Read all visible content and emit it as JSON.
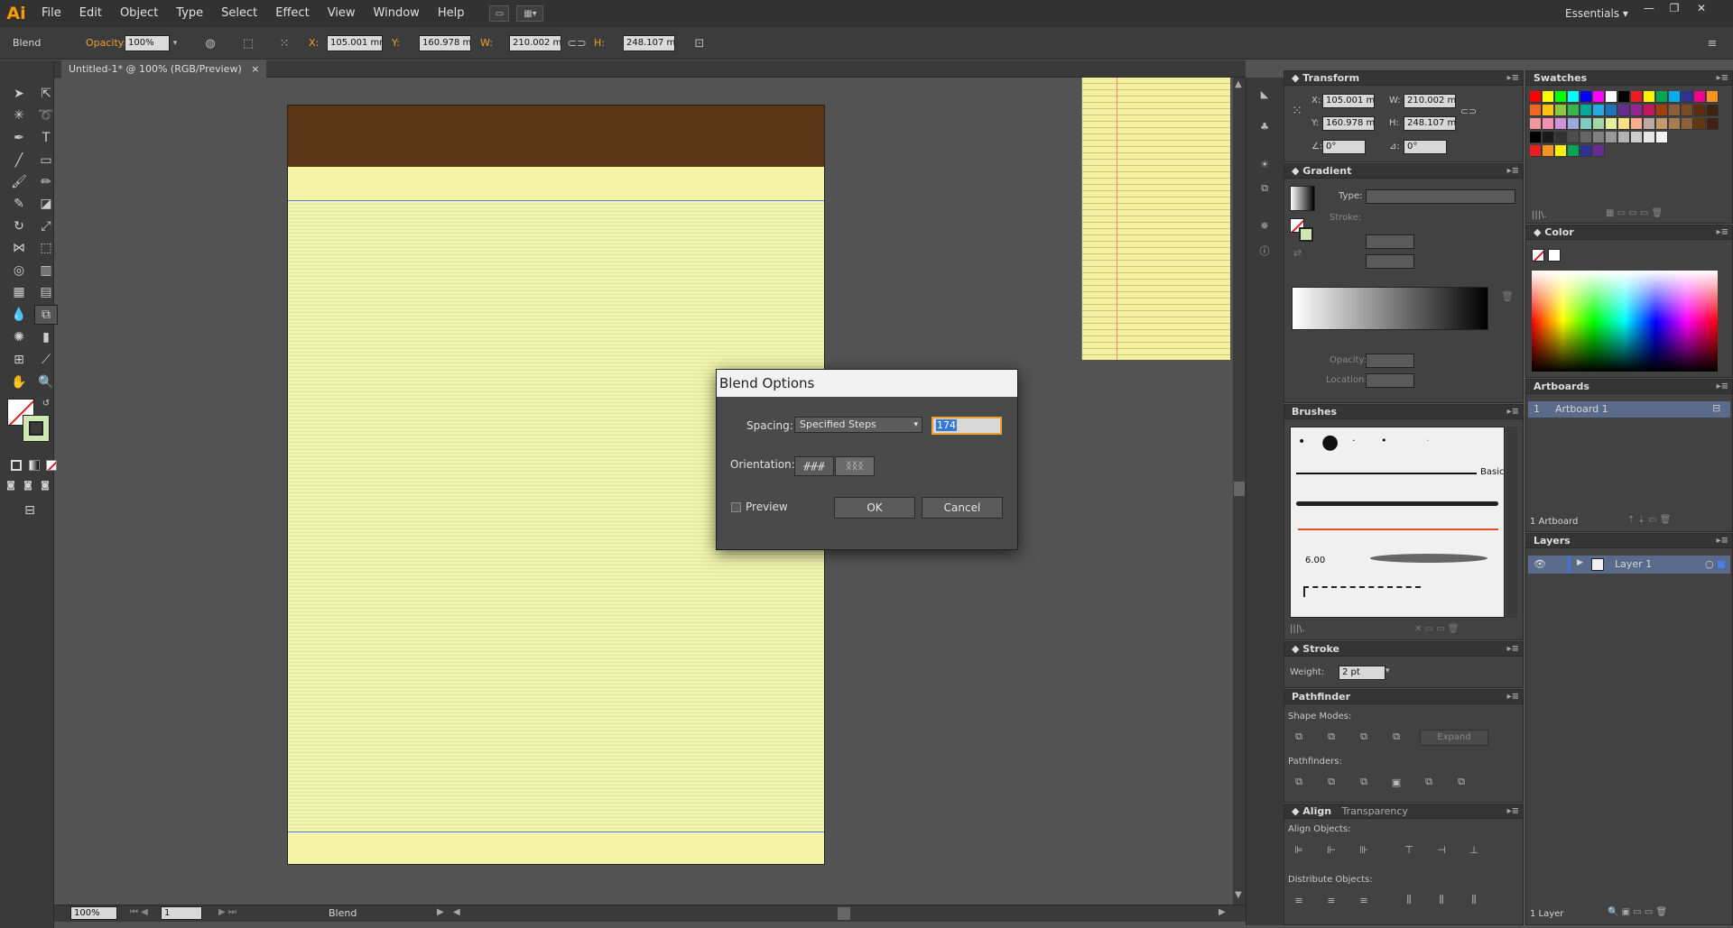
{
  "app": {
    "logo": "Ai"
  },
  "menu": [
    "File",
    "Edit",
    "Object",
    "Type",
    "Select",
    "Effect",
    "View",
    "Window",
    "Help"
  ],
  "workspace": "Essentials",
  "window_controls": {
    "minimize": "—",
    "restore": "❐",
    "close": "✕"
  },
  "control_bar": {
    "object_type": "Blend",
    "opacity_label": "Opacity:",
    "opacity_value": "100%",
    "x_label": "X:",
    "x_value": "105.001 mm",
    "y_label": "Y:",
    "y_value": "160.978 mm",
    "w_label": "W:",
    "w_value": "210.002 mm",
    "h_label": "H:",
    "h_value": "248.107 mm"
  },
  "document_tab": {
    "title": "Untitled-1* @ 100% (RGB/Preview)",
    "close": "×"
  },
  "status_bar": {
    "zoom": "100%",
    "artboard_num": "1",
    "tool_status": "Blend"
  },
  "dialog": {
    "title": "Blend Options",
    "spacing_label": "Spacing:",
    "spacing_value": "Specified Steps",
    "steps_value": "174",
    "orientation_label": "Orientation:",
    "preview_label": "Preview",
    "ok_label": "OK",
    "cancel_label": "Cancel"
  },
  "transform": {
    "title": "Transform",
    "x_label": "X:",
    "x_value": "105.001 mm",
    "y_label": "Y:",
    "y_value": "160.978 mm",
    "w_label": "W:",
    "w_value": "210.002 mm",
    "h_label": "H:",
    "h_value": "248.107 mm",
    "rotate_value": "0°",
    "shear_value": "0°"
  },
  "gradient": {
    "title": "Gradient",
    "type_label": "Type:",
    "stroke_label": "Stroke:",
    "opacity_label": "Opacity:",
    "location_label": "Location:"
  },
  "brushes": {
    "title": "Brushes",
    "basic_label": "Basic",
    "size_value": "6.00"
  },
  "stroke": {
    "title": "Stroke",
    "weight_label": "Weight:",
    "weight_value": "2 pt"
  },
  "pathfinder": {
    "title": "Pathfinder",
    "shape_modes_label": "Shape Modes:",
    "expand_label": "Expand",
    "pathfinders_label": "Pathfinders:"
  },
  "align": {
    "title": "Align",
    "transparency_tab": "Transparency",
    "align_objects_label": "Align Objects:",
    "distribute_objects_label": "Distribute Objects:"
  },
  "swatches": {
    "title": "Swatches"
  },
  "color": {
    "title": "Color"
  },
  "artboards": {
    "title": "Artboards",
    "row_num": "1",
    "row_name": "Artboard 1",
    "footer": "1 Artboard"
  },
  "layers": {
    "title": "Layers",
    "layer_name": "Layer 1",
    "footer": "1 Layer"
  },
  "colors": {
    "swatch_row1": [
      "#ff0000",
      "#ffff00",
      "#00ff00",
      "#00ffff",
      "#0000ff",
      "#ff00ff",
      "#ffffff",
      "#000000",
      "#ed1c24",
      "#fff200",
      "#00a651",
      "#00aeef",
      "#2e3192",
      "#ec008c",
      "#f7941d"
    ],
    "swatch_row2": [
      "#f26522",
      "#ffc20e",
      "#8dc63f",
      "#39b54a",
      "#00a99d",
      "#27aae1",
      "#1c75bc",
      "#662d91",
      "#92278f",
      "#c2185b",
      "#a0410d",
      "#8b5e3c",
      "#754c24",
      "#5c2d0e",
      "#3c2415"
    ],
    "swatch_row3": [
      "#ef9a9a",
      "#f48fb1",
      "#ce93d8",
      "#9fa8da",
      "#80cbc4",
      "#a5d6a7",
      "#e6ee9c",
      "#ffe082",
      "#ffab91",
      "#bcaaa4",
      "#c49a6c",
      "#a67c52",
      "#8c6239",
      "#603913",
      "#402010"
    ],
    "swatch_row4": [
      "#000000",
      "#1a1a1a",
      "#333333",
      "#4d4d4d",
      "#666666",
      "#808080",
      "#999999",
      "#b3b3b3",
      "#cccccc",
      "#e6e6e6",
      "#f2f2f2"
    ],
    "swatch_row5": [
      "#ed1c24",
      "#f7941d",
      "#fff200",
      "#00a651",
      "#2e3192",
      "#662d91"
    ]
  }
}
